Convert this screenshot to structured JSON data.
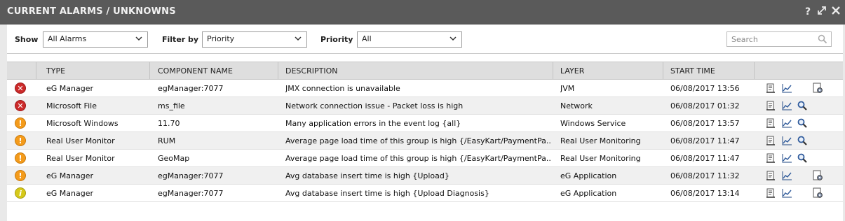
{
  "header": {
    "title": "CURRENT ALARMS / UNKNOWNS",
    "help_icon": "?",
    "expand_icon": "expand-icon",
    "close_icon": "close-icon"
  },
  "filters": {
    "show_label": "Show",
    "show_value": "All Alarms",
    "filter_by_label": "Filter by",
    "filter_by_value": "Priority",
    "priority_label": "Priority",
    "priority_value": "All",
    "search_placeholder": "Search"
  },
  "table": {
    "columns": [
      "TYPE",
      "COMPONENT NAME",
      "DESCRIPTION",
      "LAYER",
      "START TIME"
    ],
    "rows": [
      {
        "severity": "critical",
        "severity_glyph": "✕",
        "type": "eG Manager",
        "component": "egManager:7077",
        "description": "JMX connection is unavailable",
        "layer": "JVM",
        "start_time": "06/08/2017 13:56",
        "third_action": "settings"
      },
      {
        "severity": "critical",
        "severity_glyph": "✕",
        "type": "Microsoft File",
        "component": "ms_file",
        "description": "Network connection issue - Packet loss is high",
        "layer": "Network",
        "start_time": "06/08/2017 01:32",
        "third_action": "search"
      },
      {
        "severity": "major",
        "severity_glyph": "!",
        "type": "Microsoft Windows",
        "component": "11.70",
        "description": "Many application errors in the event log {all}",
        "layer": "Windows Service",
        "start_time": "06/08/2017 13:57",
        "third_action": "search"
      },
      {
        "severity": "major",
        "severity_glyph": "!",
        "type": "Real User Monitor",
        "component": "RUM",
        "description": "Average page load time of this group is high {/EasyKart/PaymentPa...",
        "layer": "Real User Monitoring",
        "start_time": "06/08/2017 11:47",
        "third_action": "search"
      },
      {
        "severity": "major",
        "severity_glyph": "!",
        "type": "Real User Monitor",
        "component": "GeoMap",
        "description": "Average page load time of this group is high {/EasyKart/PaymentPa...",
        "layer": "Real User Monitoring",
        "start_time": "06/08/2017 11:47",
        "third_action": "search"
      },
      {
        "severity": "major",
        "severity_glyph": "!",
        "type": "eG Manager",
        "component": "egManager:7077",
        "description": "Avg database insert time is high {Upload}",
        "layer": "eG Application",
        "start_time": "06/08/2017 11:32",
        "third_action": "settings"
      },
      {
        "severity": "minor",
        "severity_glyph": "i",
        "type": "eG Manager",
        "component": "egManager:7077",
        "description": "Avg database insert time is high {Upload Diagnosis}",
        "layer": "eG Application",
        "start_time": "06/08/2017 13:14",
        "third_action": "settings"
      }
    ]
  },
  "colors": {
    "critical": "#cc2a2a",
    "major": "#f49b1b",
    "minor": "#d6c91a",
    "titlebar": "#5a5a5a"
  }
}
